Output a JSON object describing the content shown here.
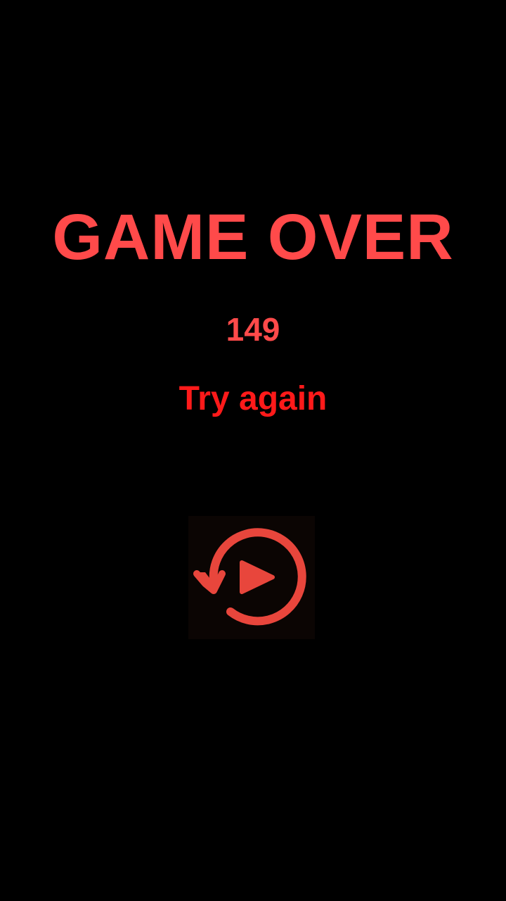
{
  "game_over": {
    "title": "GAME OVER",
    "score": "149",
    "message": "Try again",
    "replay_icon": "replay-icon",
    "colors": {
      "background": "#000000",
      "title": "#ff4a4a",
      "score": "#ff4a4a",
      "message": "#ff1a1a",
      "icon": "#e8463c"
    }
  }
}
